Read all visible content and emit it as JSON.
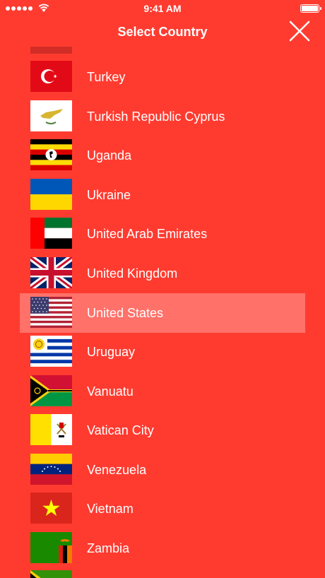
{
  "status_bar": {
    "time": "9:41 AM",
    "signal_bars": 5,
    "battery_level": 1.0
  },
  "nav": {
    "title": "Select Country",
    "close_icon": "close-icon"
  },
  "countries": [
    {
      "label": "Turkey",
      "flag_icon": "flag-turkey-icon",
      "selected": false
    },
    {
      "label": "Turkish Republic Cyprus",
      "flag_icon": "flag-turkish-republic-cyprus-icon",
      "selected": false
    },
    {
      "label": "Uganda",
      "flag_icon": "flag-uganda-icon",
      "selected": false
    },
    {
      "label": "Ukraine",
      "flag_icon": "flag-ukraine-icon",
      "selected": false
    },
    {
      "label": "United Arab Emirates",
      "flag_icon": "flag-united-arab-emirates-icon",
      "selected": false
    },
    {
      "label": "United Kingdom",
      "flag_icon": "flag-united-kingdom-icon",
      "selected": false
    },
    {
      "label": "United States",
      "flag_icon": "flag-united-states-icon",
      "selected": true
    },
    {
      "label": "Uruguay",
      "flag_icon": "flag-uruguay-icon",
      "selected": false
    },
    {
      "label": "Vanuatu",
      "flag_icon": "flag-vanuatu-icon",
      "selected": false
    },
    {
      "label": "Vatican City",
      "flag_icon": "flag-vatican-city-icon",
      "selected": false
    },
    {
      "label": "Venezuela",
      "flag_icon": "flag-venezuela-icon",
      "selected": false
    },
    {
      "label": "Vietnam",
      "flag_icon": "flag-vietnam-icon",
      "selected": false
    },
    {
      "label": "Zambia",
      "flag_icon": "flag-zambia-icon",
      "selected": false
    }
  ],
  "colors": {
    "background": "#FF3B30",
    "selected_row": "#FF7A73",
    "text": "#FFFFFF"
  }
}
